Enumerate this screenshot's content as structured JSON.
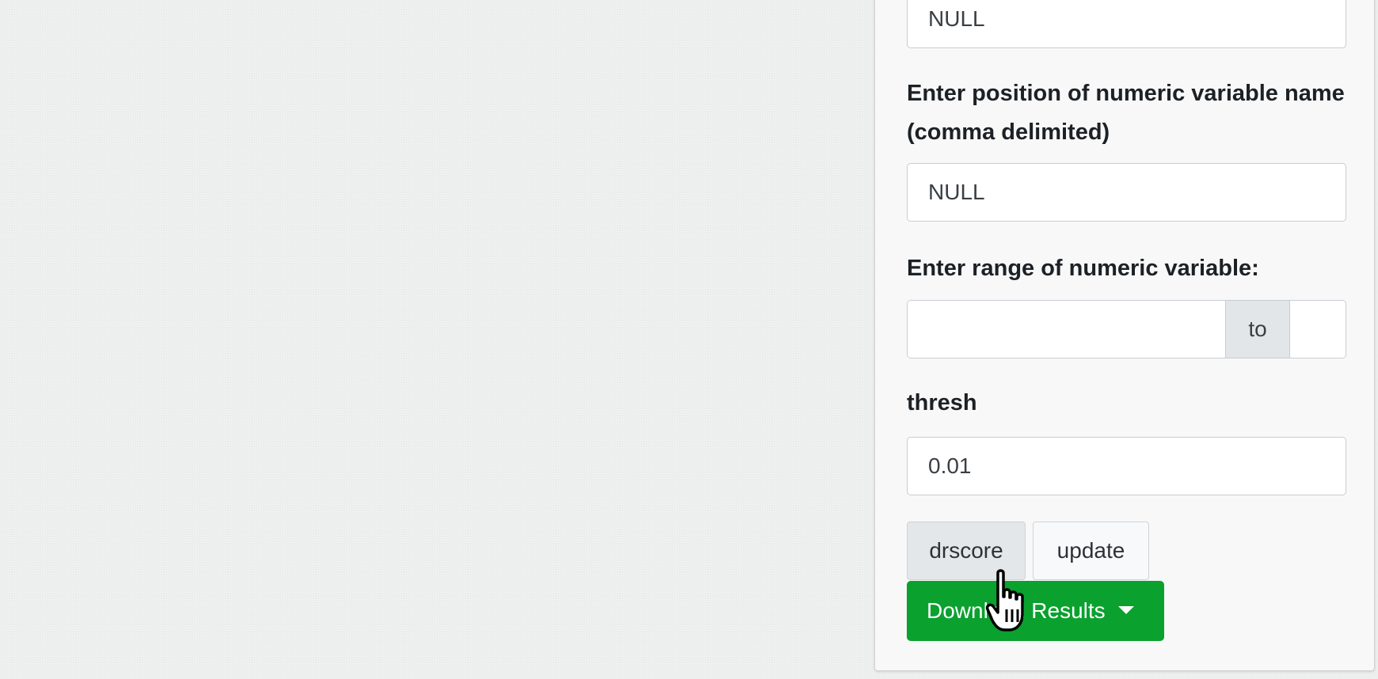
{
  "panel": {
    "top_field": {
      "value": "NULL"
    },
    "numeric_position": {
      "label": "Enter position of numeric variable name (comma delimited)",
      "value": "NULL"
    },
    "numeric_range": {
      "label": "Enter range of numeric variable:",
      "from_value": "",
      "separator": "to",
      "to_value": ""
    },
    "thresh": {
      "label": "thresh",
      "value": "0.01"
    },
    "buttons": {
      "drscore_label": "drscore",
      "update_label": "update",
      "download_label": "Download Results"
    },
    "colors": {
      "download_button": "#0aa12e",
      "panel_background": "#f8f8f8",
      "page_background": "#eceded"
    }
  },
  "cursor": {
    "icon": "hand-pointer-icon"
  }
}
